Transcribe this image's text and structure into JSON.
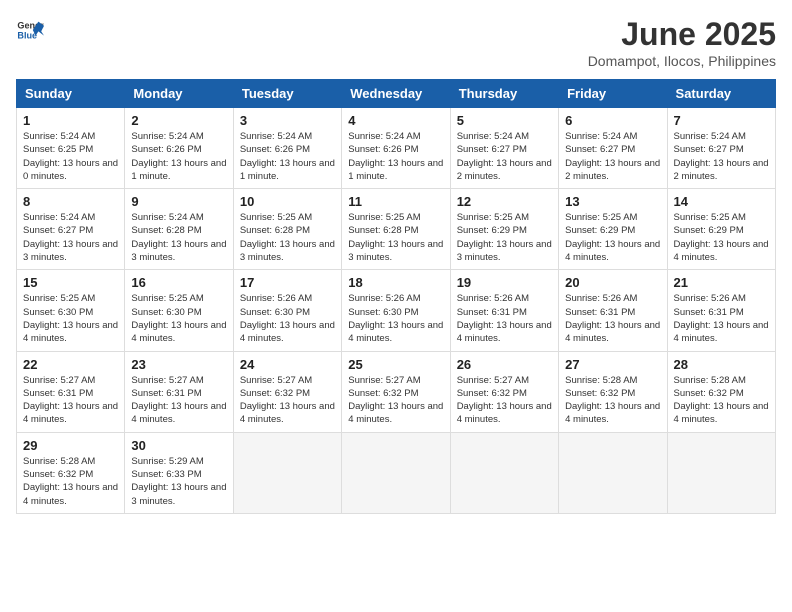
{
  "logo": {
    "general": "General",
    "blue": "Blue"
  },
  "title": "June 2025",
  "subtitle": "Domampot, Ilocos, Philippines",
  "days_of_week": [
    "Sunday",
    "Monday",
    "Tuesday",
    "Wednesday",
    "Thursday",
    "Friday",
    "Saturday"
  ],
  "weeks": [
    [
      {
        "day": 1,
        "sunrise": "5:24 AM",
        "sunset": "6:25 PM",
        "daylight": "13 hours and 0 minutes."
      },
      {
        "day": 2,
        "sunrise": "5:24 AM",
        "sunset": "6:26 PM",
        "daylight": "13 hours and 1 minute."
      },
      {
        "day": 3,
        "sunrise": "5:24 AM",
        "sunset": "6:26 PM",
        "daylight": "13 hours and 1 minute."
      },
      {
        "day": 4,
        "sunrise": "5:24 AM",
        "sunset": "6:26 PM",
        "daylight": "13 hours and 1 minute."
      },
      {
        "day": 5,
        "sunrise": "5:24 AM",
        "sunset": "6:27 PM",
        "daylight": "13 hours and 2 minutes."
      },
      {
        "day": 6,
        "sunrise": "5:24 AM",
        "sunset": "6:27 PM",
        "daylight": "13 hours and 2 minutes."
      },
      {
        "day": 7,
        "sunrise": "5:24 AM",
        "sunset": "6:27 PM",
        "daylight": "13 hours and 2 minutes."
      }
    ],
    [
      {
        "day": 8,
        "sunrise": "5:24 AM",
        "sunset": "6:27 PM",
        "daylight": "13 hours and 3 minutes."
      },
      {
        "day": 9,
        "sunrise": "5:24 AM",
        "sunset": "6:28 PM",
        "daylight": "13 hours and 3 minutes."
      },
      {
        "day": 10,
        "sunrise": "5:25 AM",
        "sunset": "6:28 PM",
        "daylight": "13 hours and 3 minutes."
      },
      {
        "day": 11,
        "sunrise": "5:25 AM",
        "sunset": "6:28 PM",
        "daylight": "13 hours and 3 minutes."
      },
      {
        "day": 12,
        "sunrise": "5:25 AM",
        "sunset": "6:29 PM",
        "daylight": "13 hours and 3 minutes."
      },
      {
        "day": 13,
        "sunrise": "5:25 AM",
        "sunset": "6:29 PM",
        "daylight": "13 hours and 4 minutes."
      },
      {
        "day": 14,
        "sunrise": "5:25 AM",
        "sunset": "6:29 PM",
        "daylight": "13 hours and 4 minutes."
      }
    ],
    [
      {
        "day": 15,
        "sunrise": "5:25 AM",
        "sunset": "6:30 PM",
        "daylight": "13 hours and 4 minutes."
      },
      {
        "day": 16,
        "sunrise": "5:25 AM",
        "sunset": "6:30 PM",
        "daylight": "13 hours and 4 minutes."
      },
      {
        "day": 17,
        "sunrise": "5:26 AM",
        "sunset": "6:30 PM",
        "daylight": "13 hours and 4 minutes."
      },
      {
        "day": 18,
        "sunrise": "5:26 AM",
        "sunset": "6:30 PM",
        "daylight": "13 hours and 4 minutes."
      },
      {
        "day": 19,
        "sunrise": "5:26 AM",
        "sunset": "6:31 PM",
        "daylight": "13 hours and 4 minutes."
      },
      {
        "day": 20,
        "sunrise": "5:26 AM",
        "sunset": "6:31 PM",
        "daylight": "13 hours and 4 minutes."
      },
      {
        "day": 21,
        "sunrise": "5:26 AM",
        "sunset": "6:31 PM",
        "daylight": "13 hours and 4 minutes."
      }
    ],
    [
      {
        "day": 22,
        "sunrise": "5:27 AM",
        "sunset": "6:31 PM",
        "daylight": "13 hours and 4 minutes."
      },
      {
        "day": 23,
        "sunrise": "5:27 AM",
        "sunset": "6:31 PM",
        "daylight": "13 hours and 4 minutes."
      },
      {
        "day": 24,
        "sunrise": "5:27 AM",
        "sunset": "6:32 PM",
        "daylight": "13 hours and 4 minutes."
      },
      {
        "day": 25,
        "sunrise": "5:27 AM",
        "sunset": "6:32 PM",
        "daylight": "13 hours and 4 minutes."
      },
      {
        "day": 26,
        "sunrise": "5:27 AM",
        "sunset": "6:32 PM",
        "daylight": "13 hours and 4 minutes."
      },
      {
        "day": 27,
        "sunrise": "5:28 AM",
        "sunset": "6:32 PM",
        "daylight": "13 hours and 4 minutes."
      },
      {
        "day": 28,
        "sunrise": "5:28 AM",
        "sunset": "6:32 PM",
        "daylight": "13 hours and 4 minutes."
      }
    ],
    [
      {
        "day": 29,
        "sunrise": "5:28 AM",
        "sunset": "6:32 PM",
        "daylight": "13 hours and 4 minutes."
      },
      {
        "day": 30,
        "sunrise": "5:29 AM",
        "sunset": "6:33 PM",
        "daylight": "13 hours and 3 minutes."
      },
      null,
      null,
      null,
      null,
      null
    ]
  ]
}
